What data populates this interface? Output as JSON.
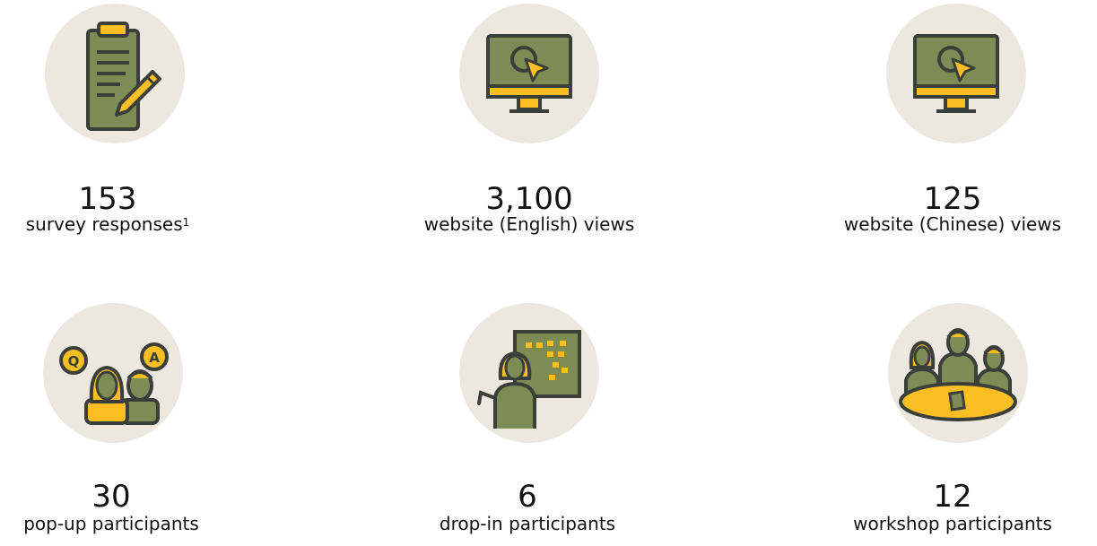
{
  "colors": {
    "circle_bg": "#ece7df",
    "olive": "#7d8b55",
    "gold": "#fbbf24",
    "outline": "#3a3f3a"
  },
  "stats": [
    {
      "icon": "survey-clipboard-icon",
      "number": "153",
      "label": "survey responses",
      "footnote": "1"
    },
    {
      "icon": "monitor-cursor-icon",
      "number": "3,100",
      "label": "website (English) views"
    },
    {
      "icon": "monitor-cursor-icon",
      "number": "125",
      "label": "website (Chinese) views"
    },
    {
      "icon": "question-answer-people-icon",
      "number": "30",
      "label": "pop-up participants"
    },
    {
      "icon": "presenter-board-icon",
      "number": "6",
      "label": "drop-in participants"
    },
    {
      "icon": "workshop-table-icon",
      "number": "12",
      "label": "workshop participants"
    }
  ]
}
